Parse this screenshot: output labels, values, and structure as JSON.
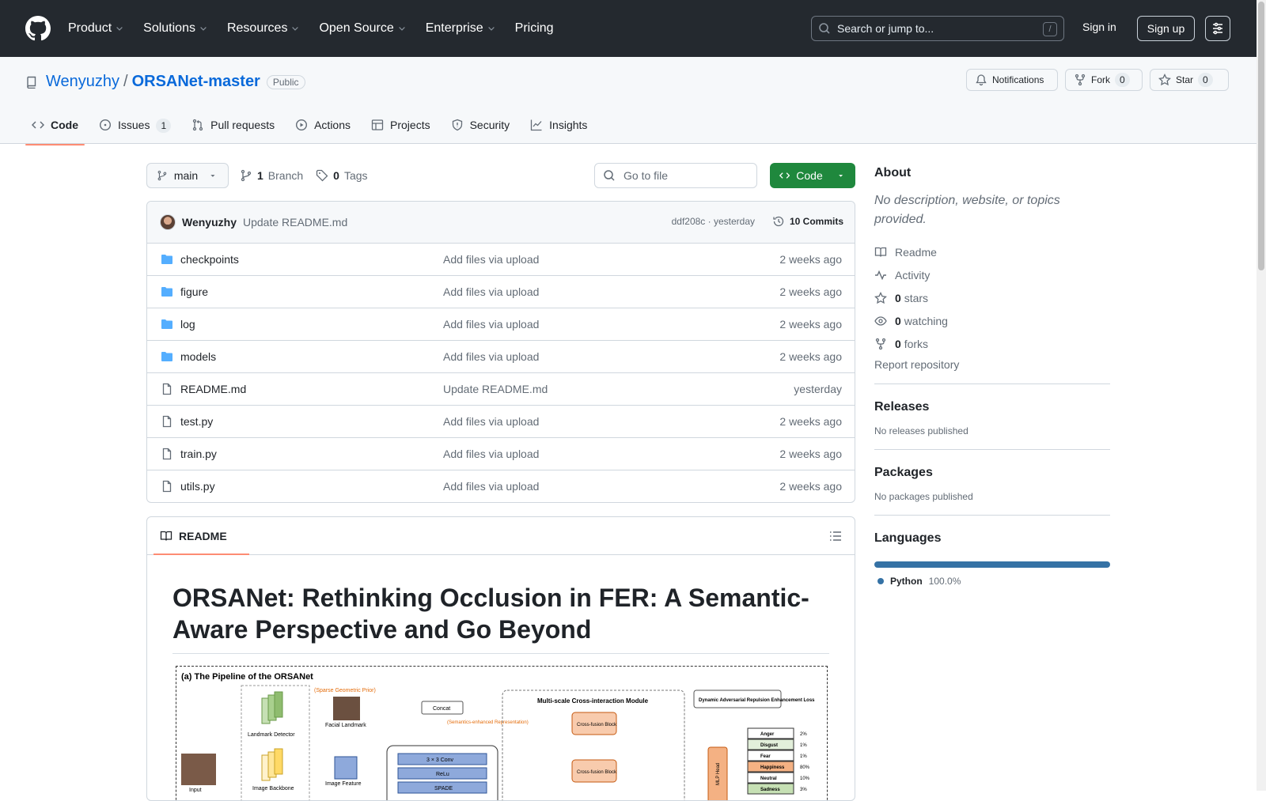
{
  "header": {
    "nav": [
      {
        "label": "Product",
        "dropdown": true
      },
      {
        "label": "Solutions",
        "dropdown": true
      },
      {
        "label": "Resources",
        "dropdown": true
      },
      {
        "label": "Open Source",
        "dropdown": true
      },
      {
        "label": "Enterprise",
        "dropdown": true
      },
      {
        "label": "Pricing",
        "dropdown": false
      }
    ],
    "search_placeholder": "Search or jump to...",
    "search_shortcut": "/",
    "sign_in": "Sign in",
    "sign_up": "Sign up"
  },
  "repo": {
    "owner": "Wenyuzhy",
    "separator": "/",
    "name": "ORSANet-master",
    "visibility": "Public",
    "notifications_label": "Notifications",
    "fork_label": "Fork",
    "fork_count": "0",
    "star_label": "Star",
    "star_count": "0"
  },
  "tabs": [
    {
      "label": "Code",
      "icon": "code-icon",
      "count": ""
    },
    {
      "label": "Issues",
      "icon": "issue-icon",
      "count": "1"
    },
    {
      "label": "Pull requests",
      "icon": "pull-request-icon",
      "count": ""
    },
    {
      "label": "Actions",
      "icon": "play-icon",
      "count": ""
    },
    {
      "label": "Projects",
      "icon": "table-icon",
      "count": ""
    },
    {
      "label": "Security",
      "icon": "shield-icon",
      "count": ""
    },
    {
      "label": "Insights",
      "icon": "graph-icon",
      "count": ""
    }
  ],
  "toolbar": {
    "branch": "main",
    "branch_count": "1",
    "branch_label": "Branch",
    "tag_count": "0",
    "tag_label": "Tags",
    "goto_file": "Go to file",
    "code_button": "Code"
  },
  "latest_commit": {
    "author": "Wenyuzhy",
    "message": "Update README.md",
    "meta": "ddf208c · yesterday",
    "commits": "10 Commits"
  },
  "files": [
    {
      "type": "dir",
      "name": "checkpoints",
      "message": "Add files via upload",
      "date": "2 weeks ago"
    },
    {
      "type": "dir",
      "name": "figure",
      "message": "Add files via upload",
      "date": "2 weeks ago"
    },
    {
      "type": "dir",
      "name": "log",
      "message": "Add files via upload",
      "date": "2 weeks ago"
    },
    {
      "type": "dir",
      "name": "models",
      "message": "Add files via upload",
      "date": "2 weeks ago"
    },
    {
      "type": "file",
      "name": "README.md",
      "message": "Update README.md",
      "date": "yesterday"
    },
    {
      "type": "file",
      "name": "test.py",
      "message": "Add files via upload",
      "date": "2 weeks ago"
    },
    {
      "type": "file",
      "name": "train.py",
      "message": "Add files via upload",
      "date": "2 weeks ago"
    },
    {
      "type": "file",
      "name": "utils.py",
      "message": "Add files via upload",
      "date": "2 weeks ago"
    }
  ],
  "readme": {
    "tab_label": "README",
    "title": "ORSANet: Rethinking Occlusion in FER: A Semantic-Aware Perspective and Go Beyond",
    "figure": {
      "caption": "(a) The Pipeline of the ORSANet",
      "labels": {
        "landmark_detector": "Landmark Detector",
        "sparse_prior": "(Sparse Geometric Prior)",
        "facial_landmark": "Facial Landmark",
        "concat": "Concat",
        "semantics": "(Semantics-enhanced Representation)",
        "msci": "Multi-scale Cross-interaction Module",
        "cross_fusion": "Cross-fusion Block",
        "dynamic_loss": "Dynamic Adversarial Repulsion Enhancement Loss",
        "input": "Input",
        "image_backbone": "Image Backbone",
        "image_feature": "Image Feature",
        "conv": "3 × 3 Conv",
        "relu": "ReLu",
        "spade": "SPADE",
        "mlp_head": "MLP Head"
      },
      "emotions": [
        {
          "name": "Anger",
          "pct": "2%"
        },
        {
          "name": "Disgust",
          "pct": "1%"
        },
        {
          "name": "Fear",
          "pct": "1%"
        },
        {
          "name": "Happiness",
          "pct": "80%"
        },
        {
          "name": "Neutral",
          "pct": "10%"
        },
        {
          "name": "Sadness",
          "pct": "3%"
        }
      ]
    }
  },
  "sidebar": {
    "about_title": "About",
    "description": "No description, website, or topics provided.",
    "items": [
      {
        "icon": "book-icon",
        "count": "",
        "label": "Readme"
      },
      {
        "icon": "pulse-icon",
        "count": "",
        "label": "Activity"
      },
      {
        "icon": "star-icon",
        "count": "0",
        "label": "stars"
      },
      {
        "icon": "eye-icon",
        "count": "0",
        "label": "watching"
      },
      {
        "icon": "fork-icon",
        "count": "0",
        "label": "forks"
      }
    ],
    "report": "Report repository",
    "releases_title": "Releases",
    "releases_text": "No releases published",
    "packages_title": "Packages",
    "packages_text": "No packages published",
    "languages_title": "Languages",
    "languages": [
      {
        "name": "Python",
        "percent": "100.0%",
        "color": "#3572A5"
      }
    ]
  }
}
